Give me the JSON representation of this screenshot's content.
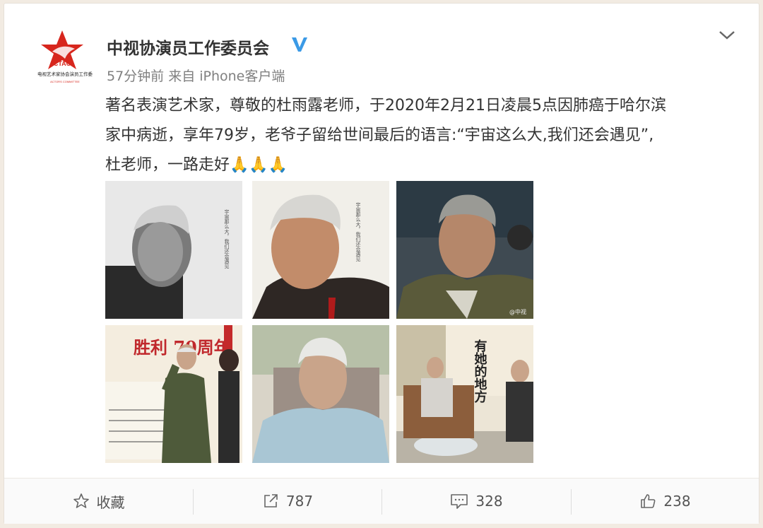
{
  "user": {
    "name": "中视协演员工作委员会",
    "avatar_text": "CTAC",
    "avatar_subtitle": "电视艺术家协会演员工作委",
    "avatar_caption": "ACTORS COMMITTEE",
    "verified_icon": "verified-v-icon"
  },
  "meta": {
    "time": "57分钟前",
    "source": "来自 iPhone客户端"
  },
  "post": {
    "line1": "著名表演艺术家，尊敬的杜雨露老师，于2020年2月21日凌晨5点因肺癌于哈尔滨",
    "line2": "家中病逝，享年79岁，老爷子留给世间最后的语言:“宇宙这么大,我们还会遇见”,",
    "line3": "杜老师，一路走好",
    "emojis": "🙏🙏🙏"
  },
  "photos": [
    {
      "id": "photo-1",
      "caption": "宇宙那么大，我们还会遇见"
    },
    {
      "id": "photo-2",
      "caption": "宇宙那么大，我们还会遇见"
    },
    {
      "id": "photo-3",
      "caption": "@中视"
    },
    {
      "id": "photo-4",
      "caption": "胜利 70周年"
    },
    {
      "id": "photo-5",
      "caption": ""
    },
    {
      "id": "photo-6",
      "caption": "有她的地方"
    }
  ],
  "toolbar": {
    "favorite_label": "收藏",
    "repost_count": "787",
    "comment_count": "328",
    "like_count": "238"
  },
  "colors": {
    "accent_red": "#d7261d",
    "verified_blue": "#3b9ae6",
    "text": "#333333",
    "meta": "#808080"
  }
}
